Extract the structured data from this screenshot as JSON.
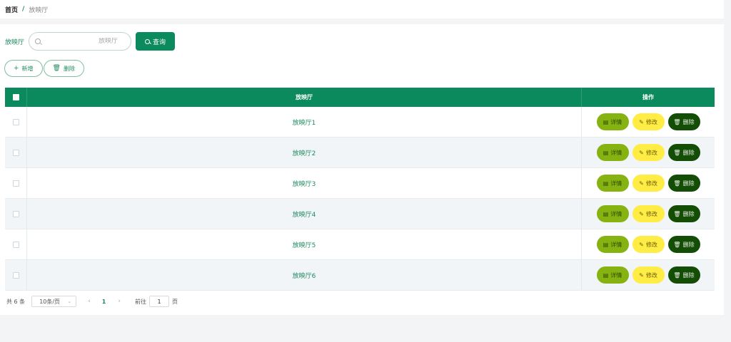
{
  "breadcrumb": {
    "home": "首页",
    "separator": "/",
    "current": "放映厅"
  },
  "search": {
    "label": "放映厅",
    "placeholder": "放映厅",
    "value": "",
    "button_label": "查询"
  },
  "actions": {
    "add_label": "新增",
    "delete_label": "删除"
  },
  "table": {
    "columns": {
      "name": "放映厅",
      "operation": "操作"
    },
    "rows": [
      {
        "name": "放映厅1"
      },
      {
        "name": "放映厅2"
      },
      {
        "name": "放映厅3"
      },
      {
        "name": "放映厅4"
      },
      {
        "name": "放映厅5"
      },
      {
        "name": "放映厅6"
      }
    ],
    "row_actions": {
      "detail": "详情",
      "edit": "修改",
      "delete": "删除"
    }
  },
  "pagination": {
    "total": "共 6 条",
    "page_size": "10条/页",
    "current_page": "1",
    "goto_label": "前往",
    "goto_value": "1",
    "goto_unit": "页"
  },
  "colors": {
    "primary": "#0b8a5e",
    "detail": "#86b311",
    "edit": "#ffec45",
    "delete": "#134d06"
  }
}
